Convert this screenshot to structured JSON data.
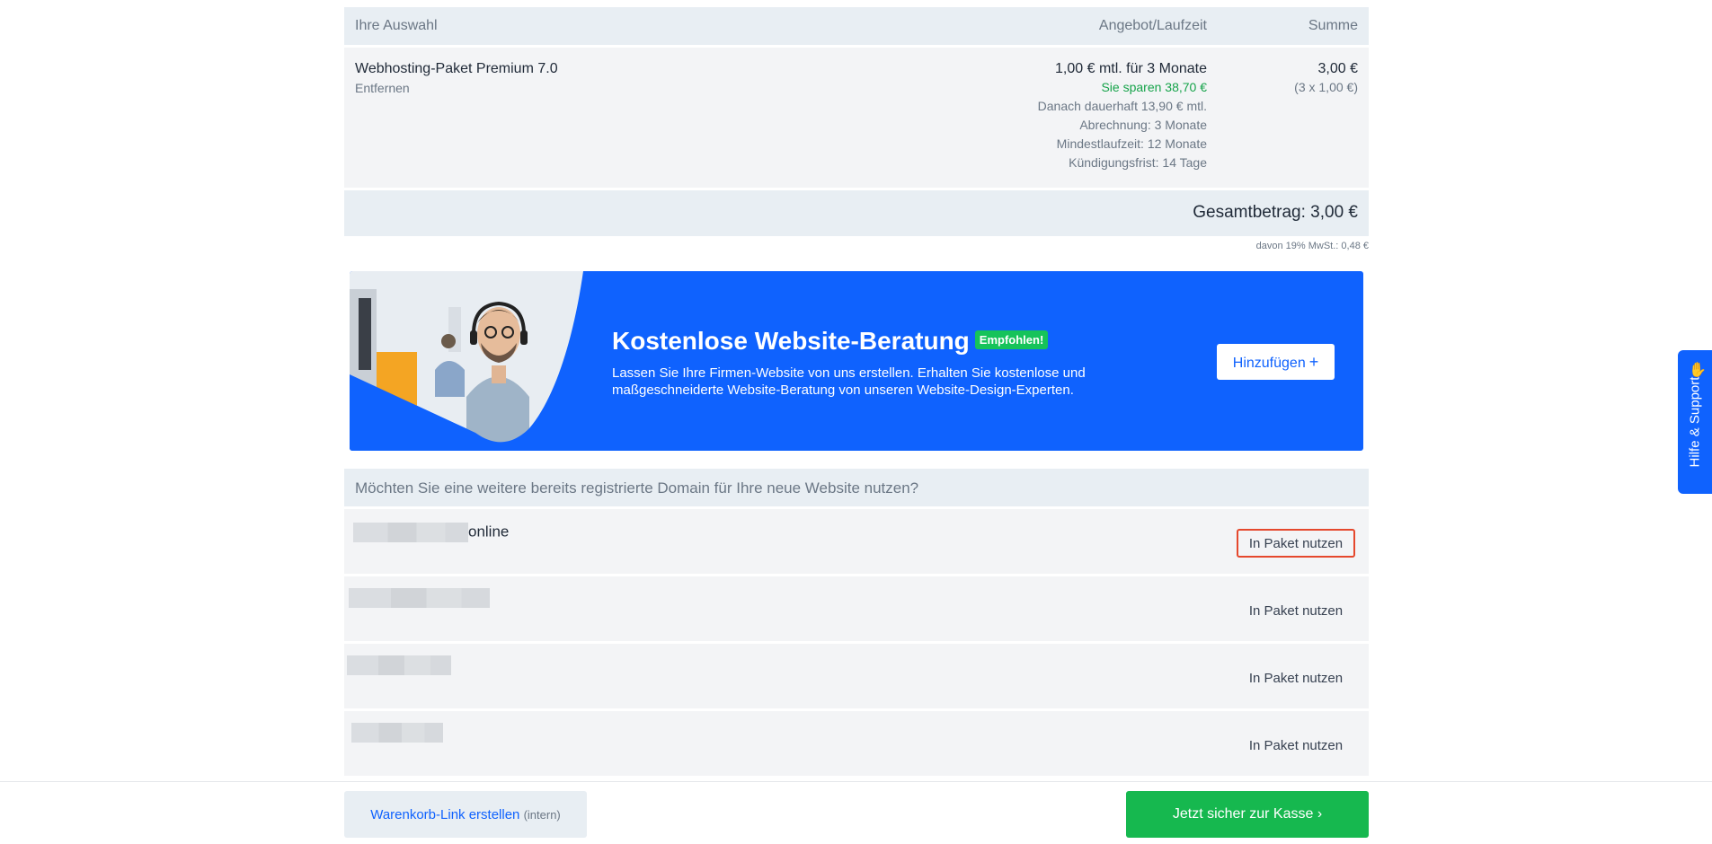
{
  "cart": {
    "headers": {
      "selection": "Ihre Auswahl",
      "offer": "Angebot/Laufzeit",
      "sum": "Summe"
    },
    "item": {
      "name": "Webhosting-Paket Premium 7.0",
      "remove": "Entfernen",
      "offer_main": "1,00 € mtl. für 3 Monate",
      "savings": "Sie sparen 38,70 €",
      "after": "Danach dauerhaft 13,90 € mtl.",
      "billing": "Abrechnung: 3 Monate",
      "min_term": "Mindestlaufzeit: 12 Monate",
      "notice": "Kündigungsfrist: 14 Tage",
      "sum": "3,00 €",
      "sum_detail": "(3 x 1,00 €)"
    },
    "total": "Gesamtbetrag: 3,00 €",
    "vat": "davon 19% MwSt.: 0,48 €"
  },
  "banner": {
    "title": "Kostenlose Website-Beratung",
    "badge": "Empfohlen!",
    "text": "Lassen Sie Ihre Firmen-Website von uns erstellen. Erhalten Sie kostenlose und maßgeschneiderte Website-Beratung von unseren Website-Design-Experten.",
    "button": "Hinzufügen",
    "button_icon": "+"
  },
  "domains": {
    "question": "Möchten Sie eine weitere bereits registrierte Domain für Ihre neue Website nutzen?",
    "rows": [
      {
        "suffix": "online",
        "button": "In Paket nutzen"
      },
      {
        "suffix": "",
        "button": "In Paket nutzen"
      },
      {
        "suffix": "",
        "button": "In Paket nutzen"
      },
      {
        "suffix": "",
        "button": "In Paket nutzen"
      }
    ]
  },
  "footer": {
    "cart_link": "Warenkorb-Link erstellen",
    "cart_link_note": "(intern)",
    "checkout": "Jetzt sicher zur Kasse",
    "checkout_icon": "›"
  },
  "help": {
    "label": "Hilfe & Support",
    "icon": "✋"
  },
  "colors": {
    "brand_blue": "#0f62fe",
    "green": "#16b84f",
    "highlight": "#e5482d"
  }
}
